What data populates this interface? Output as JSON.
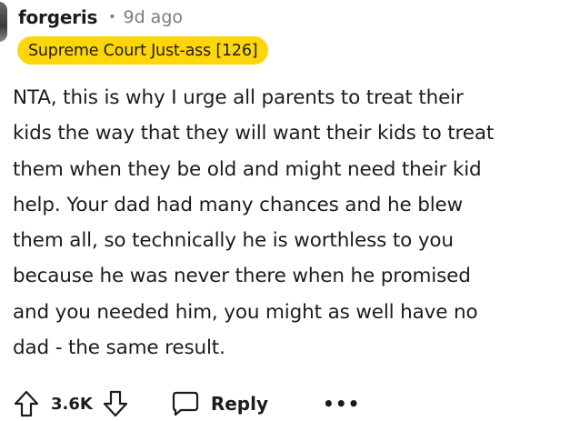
{
  "comment": {
    "username": "forgeris",
    "separator": "•",
    "timestamp": "9d ago",
    "flair": "Supreme Court Just-ass [126]",
    "flair_color": "#ffd60a",
    "lines": [
      "NTA, this is why I urge all parents to treat their",
      "kids the way that they will want their kids to treat",
      "them when they be old and might need their kid",
      "help. Your dad had many chances and he blew",
      "them all, so technically he is worthless to you",
      "because he was never there when he promised",
      "and you needed him, you might as well have no",
      "dad - the same result."
    ]
  },
  "actions": {
    "upvote_icon": "arrow-up-icon",
    "vote_count": "3.6K",
    "downvote_icon": "arrow-down-icon",
    "reply_icon": "speech-bubble-icon",
    "reply_label": "Reply",
    "more_label": "•••"
  }
}
